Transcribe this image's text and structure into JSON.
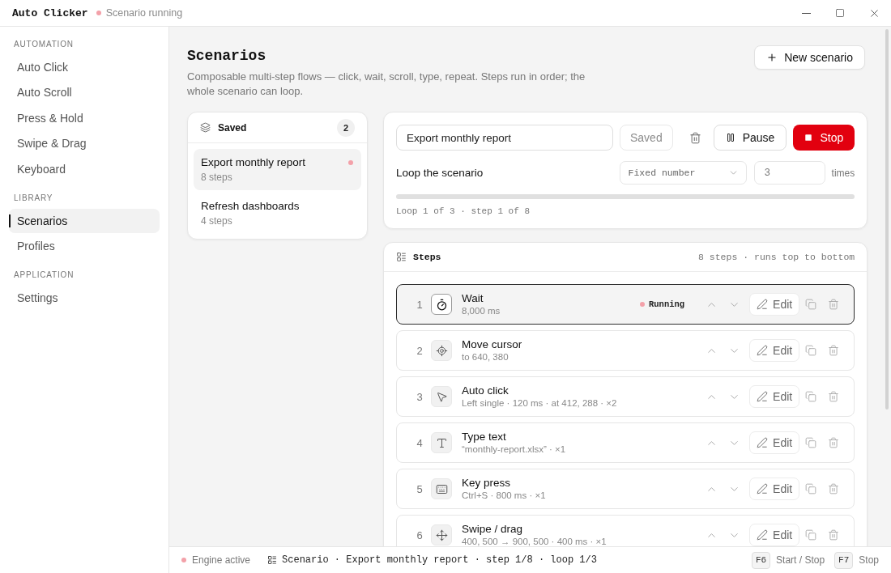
{
  "title_bar": {
    "app_name": "Auto Clicker",
    "status": "Scenario running",
    "active": true
  },
  "sidebar": {
    "sections": [
      {
        "heading": "AUTOMATION",
        "items": [
          {
            "label": "Auto Click",
            "selected": false
          },
          {
            "label": "Auto Scroll",
            "selected": false
          },
          {
            "label": "Press & Hold",
            "selected": false
          },
          {
            "label": "Swipe & Drag",
            "selected": false
          },
          {
            "label": "Keyboard",
            "selected": false
          }
        ]
      },
      {
        "heading": "LIBRARY",
        "items": [
          {
            "label": "Scenarios",
            "selected": true
          },
          {
            "label": "Profiles",
            "selected": false
          }
        ]
      },
      {
        "heading": "APPLICATION",
        "items": [
          {
            "label": "Settings",
            "selected": false
          }
        ]
      }
    ]
  },
  "page": {
    "title": "Scenarios",
    "description": "Composable multi-step flows — click, wait, scroll, type, repeat. Steps run in order; the whole scenario can loop.",
    "new_button": "New scenario"
  },
  "saved": {
    "title": "Saved",
    "count": "2",
    "items": [
      {
        "name": "Export monthly report",
        "steps": "8 steps",
        "selected": true,
        "running": true
      },
      {
        "name": "Refresh dashboards",
        "steps": "4 steps",
        "selected": false,
        "running": false
      }
    ]
  },
  "editor": {
    "name": "Export monthly report",
    "save_button": {
      "label": "Saved",
      "disabled": true
    },
    "pause_button": "Pause",
    "stop_button": "Stop",
    "loop": {
      "label": "Loop the scenario",
      "mode": "Fixed number",
      "count": "3",
      "unit": "times",
      "progress": "Loop 1 of 3 · step 1 of 8"
    }
  },
  "steps": {
    "title": "Steps",
    "summary": "8 steps · runs top to bottom",
    "items": [
      {
        "number": "1",
        "kind": "wait",
        "title": "Wait",
        "detail": "8,000 ms",
        "running": true,
        "status": "Running",
        "action": "Edit"
      },
      {
        "number": "2",
        "kind": "move",
        "title": "Move cursor",
        "detail": "to 640, 380",
        "running": false,
        "action": "Edit"
      },
      {
        "number": "3",
        "kind": "click",
        "title": "Auto click",
        "detail": "Left single · 120 ms · at 412, 288 · ×2",
        "running": false,
        "action": "Edit"
      },
      {
        "number": "4",
        "kind": "type",
        "title": "Type text",
        "detail": "“monthly-report.xlsx” · ×1",
        "running": false,
        "action": "Edit"
      },
      {
        "number": "5",
        "kind": "key",
        "title": "Key press",
        "detail": "Ctrl+S · 800 ms · ×1",
        "running": false,
        "action": "Edit"
      },
      {
        "number": "6",
        "kind": "swipe",
        "title": "Swipe / drag",
        "detail": "400, 500 → 900, 500 · 400 ms · ×1",
        "running": false,
        "action": "Edit"
      }
    ]
  },
  "status_bar": {
    "engine": {
      "label": "Engine active",
      "active": true
    },
    "summary": "Scenario · Export monthly report · step 1/8 · loop 1/3",
    "shortcuts": [
      {
        "key": "F6",
        "label": "Start / Stop"
      },
      {
        "key": "F7",
        "label": "Stop"
      }
    ]
  }
}
